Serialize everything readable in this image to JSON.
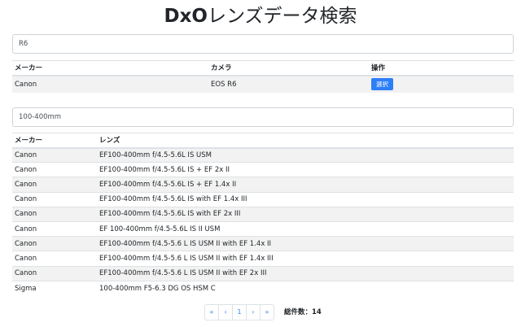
{
  "header": {
    "title_brand": "DxO",
    "title_rest": "レンズデータ検索"
  },
  "camera_search": {
    "value": "R6",
    "columns": {
      "maker": "メーカー",
      "camera": "カメラ",
      "action": "操作"
    },
    "rows": [
      {
        "maker": "Canon",
        "camera": "EOS R6",
        "action_label": "選択"
      }
    ]
  },
  "lens_search": {
    "value": "100-400mm",
    "columns": {
      "maker": "メーカー",
      "lens": "レンズ"
    },
    "rows": [
      {
        "maker": "Canon",
        "lens": "EF100-400mm f/4.5-5.6L IS USM"
      },
      {
        "maker": "Canon",
        "lens": "EF100-400mm f/4.5-5.6L IS + EF 2x II"
      },
      {
        "maker": "Canon",
        "lens": "EF100-400mm f/4.5-5.6L IS + EF 1.4x II"
      },
      {
        "maker": "Canon",
        "lens": "EF100-400mm f/4.5-5.6L IS with EF 1.4x III"
      },
      {
        "maker": "Canon",
        "lens": "EF100-400mm f/4.5-5.6L IS with EF 2x III"
      },
      {
        "maker": "Canon",
        "lens": "EF 100-400mm f/4.5-5.6L IS II USM"
      },
      {
        "maker": "Canon",
        "lens": "EF100-400mm f/4.5-5.6 L IS USM II with EF 1.4x II"
      },
      {
        "maker": "Canon",
        "lens": "EF100-400mm f/4.5-5.6 L IS USM II with EF 1.4x III"
      },
      {
        "maker": "Canon",
        "lens": "EF100-400mm f/4.5-5.6 L IS USM II with EF 2x III"
      },
      {
        "maker": "Sigma",
        "lens": "100-400mm F5-6.3 DG OS HSM C"
      }
    ]
  },
  "pagination": {
    "first": "«",
    "prev": "‹",
    "current": "1",
    "next": "›",
    "last": "»",
    "total_label": "総件数：14"
  }
}
